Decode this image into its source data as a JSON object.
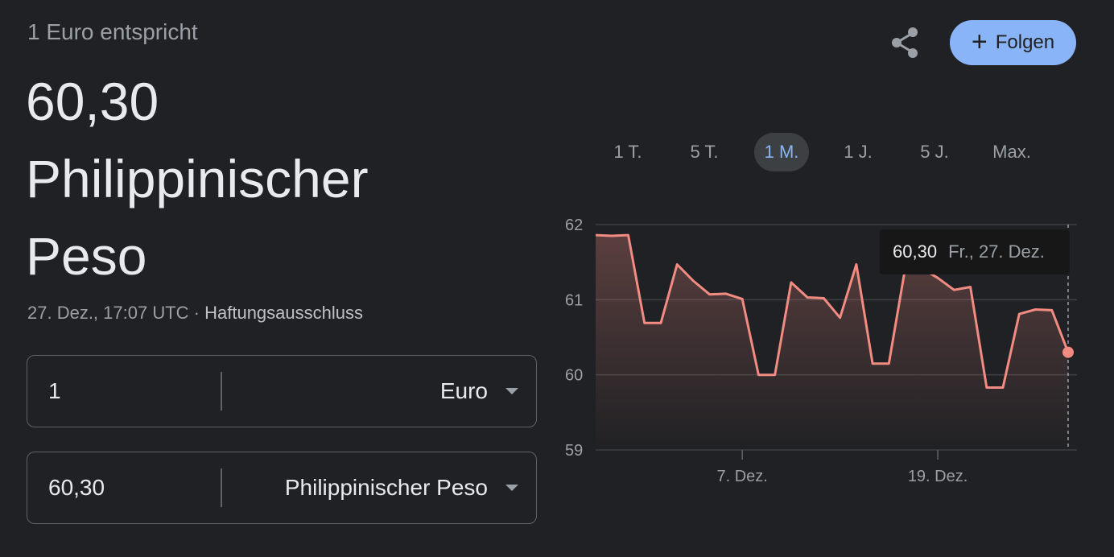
{
  "header": {
    "subtitle": "1 Euro entspricht",
    "result_value": "60,30",
    "result_currency_line1": "Philippinischer",
    "result_currency_line2": "Peso",
    "timestamp": "27. Dez., 17:07 UTC",
    "separator": " · ",
    "disclaimer": "Haftungsausschluss"
  },
  "actions": {
    "share_icon": "share-icon",
    "follow_label": "Folgen",
    "follow_icon": "plus-icon",
    "accent_color": "#8ab4f8"
  },
  "converter": {
    "from": {
      "amount": "1",
      "currency": "Euro"
    },
    "to": {
      "amount": "60,30",
      "currency": "Philippinischer Peso"
    }
  },
  "tabs": [
    {
      "label": "1 T.",
      "active": false
    },
    {
      "label": "5 T.",
      "active": false
    },
    {
      "label": "1 M.",
      "active": true
    },
    {
      "label": "1 J.",
      "active": false
    },
    {
      "label": "5 J.",
      "active": false
    },
    {
      "label": "Max.",
      "active": false
    }
  ],
  "tooltip": {
    "value": "60,30",
    "date": "Fr., 27. Dez."
  },
  "chart_data": {
    "type": "area",
    "title": "",
    "xlabel": "",
    "ylabel": "",
    "ylim": [
      59,
      62
    ],
    "y_ticks": [
      "59",
      "60",
      "61",
      "62"
    ],
    "x_ticks": [
      {
        "label": "7. Dez.",
        "index": 9
      },
      {
        "label": "19. Dez.",
        "index": 21
      }
    ],
    "line_color": "#f28b82",
    "grid": true,
    "values": [
      61.86,
      61.85,
      61.86,
      60.69,
      60.69,
      61.47,
      61.25,
      61.07,
      61.08,
      61.01,
      60.0,
      60.0,
      61.23,
      61.03,
      61.02,
      60.76,
      61.47,
      60.15,
      60.15,
      61.42,
      61.42,
      61.29,
      61.13,
      61.17,
      59.83,
      59.83,
      60.81,
      60.87,
      60.86,
      60.3
    ]
  }
}
